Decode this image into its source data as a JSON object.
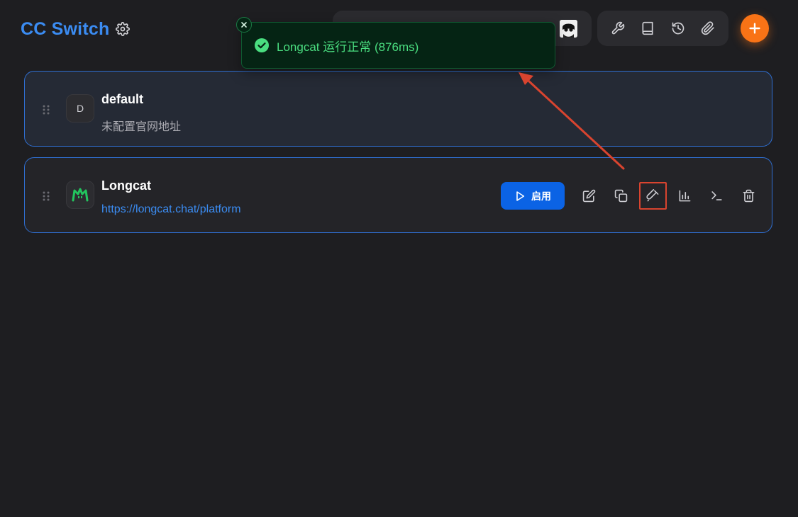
{
  "header": {
    "app_title": "CC Switch",
    "settings_icon": "gear-icon",
    "tools": [
      {
        "name": "wrench-icon"
      },
      {
        "name": "book-icon"
      },
      {
        "name": "history-icon"
      },
      {
        "name": "paperclip-icon"
      }
    ],
    "add_icon": "plus-icon",
    "accent_color": "#3b8cf2",
    "add_color": "#f97316"
  },
  "toast": {
    "message": "Longcat 运行正常 (876ms)",
    "status": "success",
    "color": "#4ade80"
  },
  "providers": [
    {
      "name": "default",
      "initial": "D",
      "subtitle": "未配置官网地址"
    },
    {
      "name": "Longcat",
      "subtitle": "https://longcat.chat/platform",
      "enable_label": "启用",
      "actions": [
        "edit-icon",
        "copy-icon",
        "test-icon",
        "chart-icon",
        "terminal-icon",
        "trash-icon"
      ]
    }
  ]
}
